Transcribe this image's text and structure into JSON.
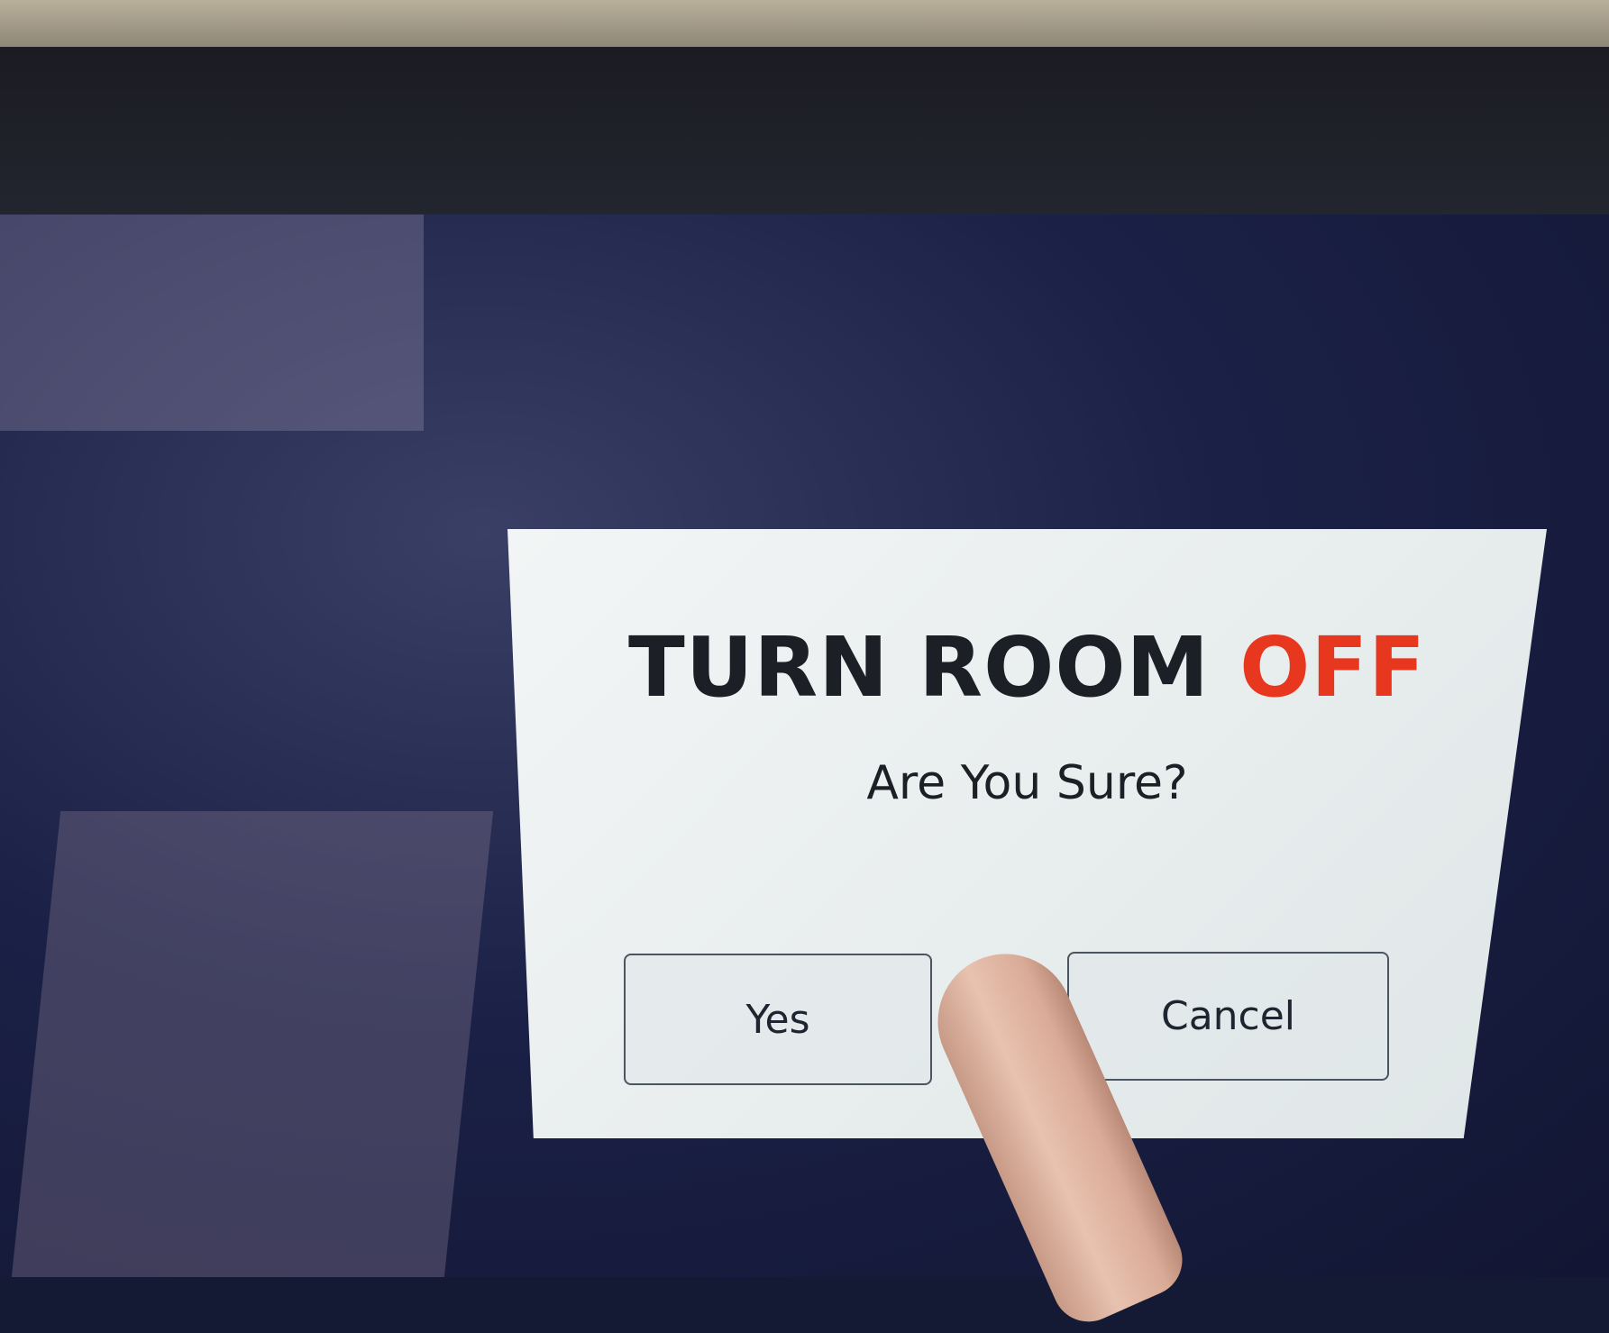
{
  "dialog": {
    "title_main": "TURN ROOM ",
    "title_accent": "OFF",
    "subtitle": "Are You Sure?",
    "buttons": {
      "yes": "Yes",
      "cancel": "Cancel"
    }
  },
  "colors": {
    "accent": "#e8371f",
    "text": "#1c2026",
    "dialog_background": "#eef2f2",
    "screen_background": "#1b2147"
  }
}
